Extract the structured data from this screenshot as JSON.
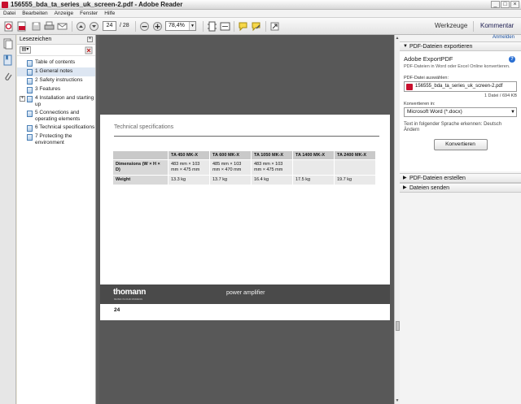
{
  "window": {
    "title": "156555_bda_ta_series_uk_screen-2.pdf - Adobe Reader"
  },
  "menu": [
    "Datei",
    "Bearbeiten",
    "Anzeige",
    "Fenster",
    "Hilfe"
  ],
  "toolbar": {
    "page_current": "24",
    "page_total": "/ 28",
    "zoom": "78,4%",
    "werkzeuge": "Werkzeuge",
    "kommentar": "Kommentar"
  },
  "bookmarks": {
    "title": "Lesezeichen",
    "items": [
      {
        "label": "Table of contents"
      },
      {
        "label": "1   General notes"
      },
      {
        "label": "2   Safety instructions"
      },
      {
        "label": "3   Features"
      },
      {
        "label": "4   Installation and starting up"
      },
      {
        "label": "5   Connections and operating elements"
      },
      {
        "label": "6   Technical specifications"
      },
      {
        "label": "7   Protecting the environment"
      }
    ]
  },
  "page": {
    "heading": "Technical specifications",
    "columns": [
      "",
      "TA 450 MK-X",
      "TA 600 MK-X",
      "TA 1050 MK-X",
      "TA 1400 MK-X",
      "TA 2400 MK-X"
    ],
    "rows": [
      [
        "Dimensions (W × H × D)",
        "483 mm × 103 mm × 475 mm",
        "485 mm × 103 mm × 470 mm",
        "483 mm × 103 mm × 475 mm",
        "",
        ""
      ],
      [
        "Weight",
        "13.3 kg",
        "13.7 kg",
        "16.4 kg",
        "17.5 kg",
        "19.7 kg"
      ]
    ],
    "logo": "thomann",
    "logo_tagline": "MUSIC IS OUR PASSION",
    "product": "power amplifier",
    "page_number": "24"
  },
  "right_panel": {
    "anmelden": "Anmelden",
    "export_section": "PDF-Dateien exportieren",
    "export_title": "Adobe ExportPDF",
    "export_desc": "PDF-Dateien in Word oder Excel Online konvertieren.",
    "select_label": "PDF-Datei auswählen:",
    "file_name": "156555_bda_ta_series_uk_screen-2.pdf",
    "file_count": "1 Datei / 694 KB",
    "convert_label": "Konvertieren in:",
    "convert_option": "Microsoft Word (*.docx)",
    "recognize": "Text in folgender Sprache erkennen: Deutsch",
    "recognize_link": "Ändern",
    "convert_button": "Konvertieren",
    "create_section": "PDF-Dateien erstellen",
    "send_section": "Dateien senden"
  }
}
